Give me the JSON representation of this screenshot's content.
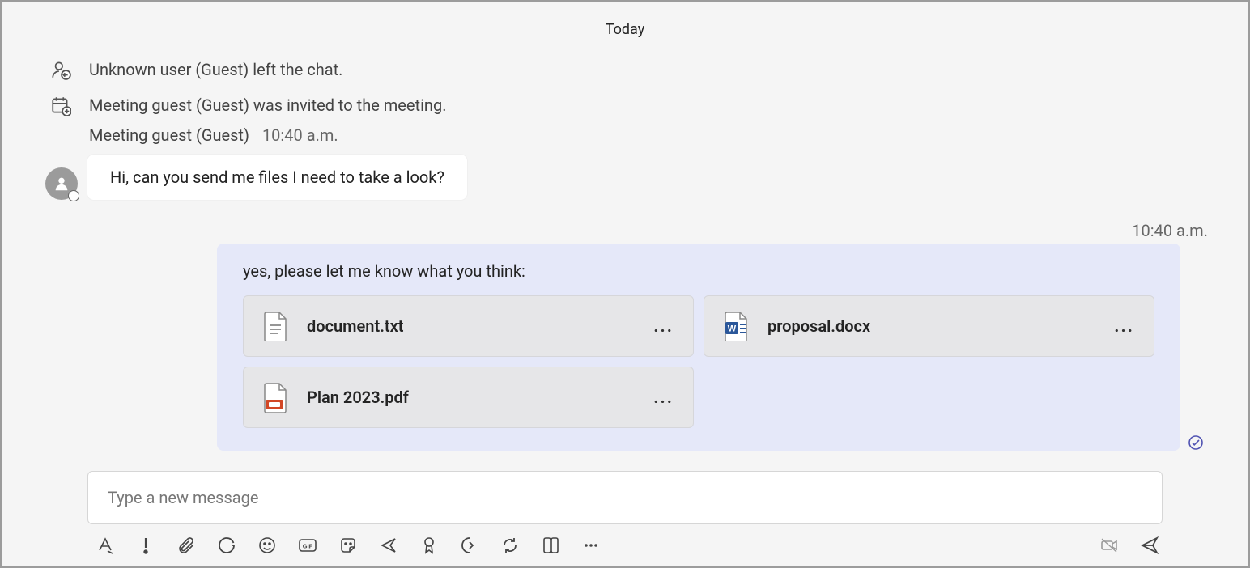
{
  "date_divider": "Today",
  "system_events": [
    {
      "icon": "user-left-icon",
      "text": "Unknown user (Guest) left the chat."
    },
    {
      "icon": "calendar-add-icon",
      "text": "Meeting guest (Guest) was invited to the meeting."
    }
  ],
  "incoming": {
    "author": "Meeting guest (Guest)",
    "timestamp": "10:40 a.m.",
    "text": "Hi, can you send me files I need to take a look?"
  },
  "outgoing": {
    "timestamp": "10:40 a.m.",
    "text": "yes, please let me know what you think:",
    "files": [
      {
        "name": "document.txt",
        "type": "txt"
      },
      {
        "name": "proposal.docx",
        "type": "docx"
      },
      {
        "name": "Plan 2023.pdf",
        "type": "ppt"
      }
    ]
  },
  "composer": {
    "placeholder": "Type a new message"
  },
  "toolbar": {
    "format": "Format",
    "priority": "Set delivery options",
    "attach": "Attach",
    "loop": "Loop",
    "emoji": "Emoji",
    "gif": "GIF",
    "sticker": "Sticker",
    "share": "Share",
    "approval": "Approvals",
    "stream": "Stream",
    "updates": "Viva",
    "apps": "Apps",
    "more": "More",
    "camera": "Video clip",
    "send": "Send"
  },
  "more_label": "..."
}
